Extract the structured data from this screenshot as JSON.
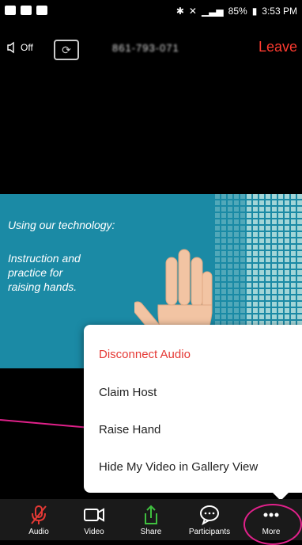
{
  "status_bar": {
    "battery_percent": "85%",
    "time": "3:53 PM"
  },
  "topbar": {
    "speaker_label": "Off",
    "meeting_id": "861-793-071",
    "leave_label": "Leave"
  },
  "share": {
    "headline": "Using our technology:",
    "body": [
      "Instruction and",
      "practice for",
      "raising hands."
    ]
  },
  "menu": {
    "items": [
      "Disconnect Audio",
      "Claim Host",
      "Raise Hand",
      "Hide My Video in Gallery View"
    ],
    "danger_color": "#e53935"
  },
  "toolbar": {
    "audio_label": "Audio",
    "video_label": "Video",
    "share_label": "Share",
    "participants_label": "Participants",
    "more_label": "More"
  },
  "colors": {
    "accent_annotation": "#e0218a",
    "share_bg": "#1b8aa5",
    "leave": "#ff3b30"
  }
}
